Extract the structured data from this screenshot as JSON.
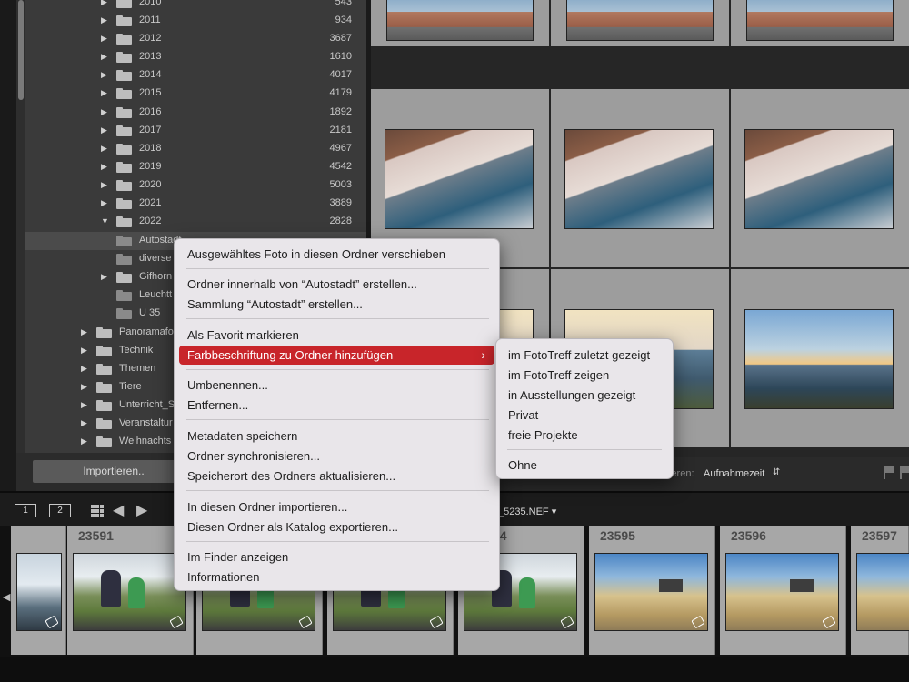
{
  "folders": [
    {
      "name": "2010",
      "count": "543"
    },
    {
      "name": "2011",
      "count": "934"
    },
    {
      "name": "2012",
      "count": "3687"
    },
    {
      "name": "2013",
      "count": "1610"
    },
    {
      "name": "2014",
      "count": "4017"
    },
    {
      "name": "2015",
      "count": "4179"
    },
    {
      "name": "2016",
      "count": "1892"
    },
    {
      "name": "2017",
      "count": "2181"
    },
    {
      "name": "2018",
      "count": "4967"
    },
    {
      "name": "2019",
      "count": "4542"
    },
    {
      "name": "2020",
      "count": "5003"
    },
    {
      "name": "2021",
      "count": "3889"
    },
    {
      "name": "2022",
      "count": "2828"
    }
  ],
  "subfolders": [
    {
      "name": "Autostadt"
    },
    {
      "name": "diverse"
    },
    {
      "name": "Gifhorn"
    },
    {
      "name": "Leuchtt"
    },
    {
      "name": "U 35"
    }
  ],
  "topfolders": [
    {
      "name": "Panoramafo"
    },
    {
      "name": "Technik"
    },
    {
      "name": "Themen"
    },
    {
      "name": "Tiere"
    },
    {
      "name": "Unterricht_S"
    },
    {
      "name": "Veranstaltur"
    },
    {
      "name": "Weihnachts"
    }
  ],
  "import_button": "Importieren..",
  "toolbar": {
    "sort_label": "ieren:",
    "sort_value": "Aufnahmezeit"
  },
  "monitor_buttons": [
    "1",
    "2"
  ],
  "filmstrip": {
    "filename": "_5235.NEF",
    "numbers": [
      "23591",
      "",
      "",
      "94",
      "23595",
      "23596",
      "23597"
    ]
  },
  "context_menu": {
    "items": [
      "Ausgewähltes Foto in diesen Ordner verschieben",
      "Ordner innerhalb von “Autostadt” erstellen...",
      "Sammlung “Autostadt” erstellen...",
      "Als Favorit markieren",
      "Farbbeschriftung zu Ordner hinzufügen",
      "Umbenennen...",
      "Entfernen...",
      "Metadaten speichern",
      "Ordner synchronisieren...",
      "Speicherort des Ordners aktualisieren...",
      "In diesen Ordner importieren...",
      "Diesen Ordner als Katalog exportieren...",
      "Im Finder anzeigen",
      "Informationen"
    ],
    "active_index": 4
  },
  "submenu": {
    "items": [
      "im FotoTreff zuletzt gezeigt",
      "im FotoTreff zeigen",
      "in Ausstellungen gezeigt",
      "Privat",
      "freie Projekte",
      "Ohne"
    ]
  },
  "colors": {
    "menu_highlight": "#c8252a",
    "panel_bg": "#3a3a3a",
    "grid_cell": "#9d9d9d"
  }
}
